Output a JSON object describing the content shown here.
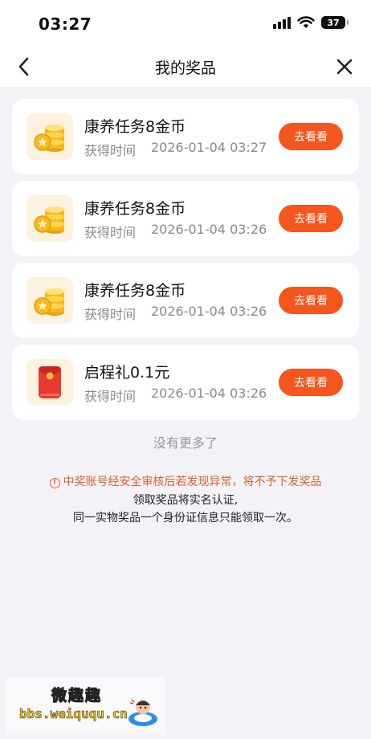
{
  "status_bar": {
    "time": "03:27",
    "battery": "37"
  },
  "nav": {
    "title": "我的奖品"
  },
  "prizes": [
    {
      "title": "康养任务8金币",
      "time_label": "获得时间",
      "time": "2026-01-04 03:27",
      "button": "去看看",
      "icon": "gold-coins-icon"
    },
    {
      "title": "康养任务8金币",
      "time_label": "获得时间",
      "time": "2026-01-04 03:26",
      "button": "去看看",
      "icon": "gold-coins-icon"
    },
    {
      "title": "康养任务8金币",
      "time_label": "获得时间",
      "time": "2026-01-04 03:26",
      "button": "去看看",
      "icon": "gold-coins-icon"
    },
    {
      "title": "启程礼0.1元",
      "time_label": "获得时间",
      "time": "2026-01-04 03:26",
      "button": "去看看",
      "icon": "red-envelope-icon"
    }
  ],
  "list_end": "没有更多了",
  "notice": {
    "warning": "中奖账号经安全审核后若发现异常，将不予下发奖品",
    "line2": "领取奖品将实名认证,",
    "line3": "同一实物奖品一个身份证信息只能领取一次。"
  },
  "watermark": {
    "title": "微趣趣",
    "url": "bbs.weiququ.cn"
  },
  "colors": {
    "accent": "#f4561d",
    "warning": "#e0602a",
    "background": "#f2f2f7"
  }
}
